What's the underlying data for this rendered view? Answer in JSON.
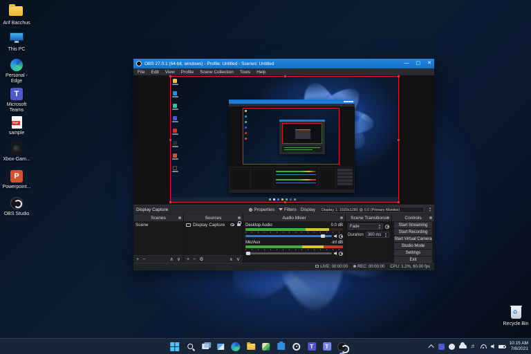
{
  "desktop": {
    "icons": [
      {
        "name": "folder-arif-bacchus",
        "label": "Arif Bacchus"
      },
      {
        "name": "this-pc",
        "label": "This PC"
      },
      {
        "name": "edge-personal",
        "label": "Personal - Edge"
      },
      {
        "name": "microsoft-teams",
        "label": "Microsoft Teams"
      },
      {
        "name": "pdf-sample",
        "label": "sample"
      },
      {
        "name": "xbox-game",
        "label": "Xbox-Gam..."
      },
      {
        "name": "powerpoint",
        "label": "Powerpoint..."
      },
      {
        "name": "obs-studio",
        "label": "OBS Studio"
      }
    ],
    "recycle_bin_label": "Recycle Bin"
  },
  "obs": {
    "title": "OBS 27.0.1 (64-bit, windows) - Profile: Untitled - Scenes: Untitled",
    "titlebar": {
      "minimize": "—",
      "maximize": "▢",
      "close": "✕"
    },
    "menus": [
      "File",
      "Edit",
      "View",
      "Profile",
      "Scene Collection",
      "Tools",
      "Help"
    ],
    "source_row": {
      "source_name": "Display Capture",
      "properties_label": "Properties",
      "filters_label": "Filters",
      "display_label": "Display",
      "display_value": "Display 1: 1920x1280 @ 0,0 (Primary Monitor)"
    },
    "panels": {
      "scenes": {
        "title": "Scenes",
        "items": [
          "Scene"
        ],
        "toolbar": [
          "+",
          "−",
          "∧",
          "∨"
        ]
      },
      "sources": {
        "title": "Sources",
        "items": [
          "Display Capture"
        ],
        "toolbar": [
          "+",
          "−",
          "⚙",
          "∧",
          "∨"
        ]
      },
      "mixer": {
        "title": "Audio Mixer",
        "channels": [
          {
            "name": "Desktop Audio",
            "db": "0.0 dB"
          },
          {
            "name": "Mic/Aux",
            "db": "-inf dB"
          }
        ]
      },
      "transitions": {
        "title": "Scene Transitions",
        "transition_value": "Fade",
        "duration_label": "Duration",
        "duration_value": "300 ms"
      },
      "controls": {
        "title": "Controls",
        "buttons": [
          "Start Streaming",
          "Start Recording",
          "Start Virtual Camera",
          "Studio Mode",
          "Settings",
          "Exit"
        ]
      }
    },
    "status": {
      "live": "LIVE: 00:00:00",
      "rec": "REC: 00:00:00",
      "cpu": "CPU: 1.2%, 60.00 fps"
    }
  },
  "taskbar": {
    "clock": {
      "time": "10:15 AM",
      "date": "7/8/2021"
    }
  },
  "colors": {
    "titlebar_blue": "#1b7ad3",
    "selection_red": "#e01f1f",
    "meter_green": "#3fae3f",
    "meter_yellow": "#d6c430",
    "meter_red": "#c0392b",
    "slider_blue": "#3a78c2",
    "bloom_blue": "#2f6fe0"
  }
}
